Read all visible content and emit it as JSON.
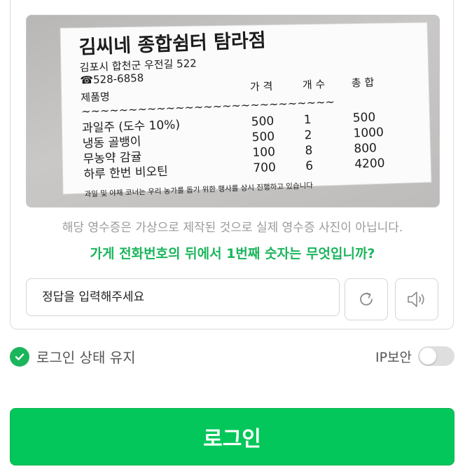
{
  "captcha": {
    "receipt": {
      "store_name": "김씨네 종합쉼터 탐라점",
      "address": "김포시 합천군 우전길 522",
      "phone": "☎528-6858",
      "headers": [
        "제품명",
        "가 격",
        "개 수",
        "총 합"
      ],
      "separator": "~~~~~~~~~~~~~~~~~~~~~~~~~~~",
      "items": [
        {
          "name": "과일주 (도수 10%)",
          "price": "500",
          "qty": "1",
          "total": "500"
        },
        {
          "name": "냉동 골뱅이",
          "price": "500",
          "qty": "2",
          "total": "1000"
        },
        {
          "name": "무농약 감귤",
          "price": "100",
          "qty": "8",
          "total": "800"
        },
        {
          "name": "하루 한번 비오틴",
          "price": "700",
          "qty": "6",
          "total": "4200"
        }
      ],
      "footer": "과일 및 야채 코너는 우리 농가를 돕기 위한 행사를 상시 진행하고 있습니다"
    },
    "notice": "해당 영수증은 가상으로 제작된 것으로 실제 영수증 사진이 아닙니다.",
    "question": "가게 전화번호의 뒤에서 1번째 숫자는 무엇입니까?",
    "input_placeholder": "정답을 입력해주세요",
    "refresh_icon": "refresh-icon",
    "audio_icon": "speaker-icon"
  },
  "options": {
    "keep_login_label": "로그인 상태 유지",
    "keep_login_checked": true,
    "ip_security_label": "IP보안",
    "ip_security_on": false
  },
  "login_button": "로그인",
  "colors": {
    "accent": "#03c75a",
    "question_text": "#1bb55c"
  }
}
